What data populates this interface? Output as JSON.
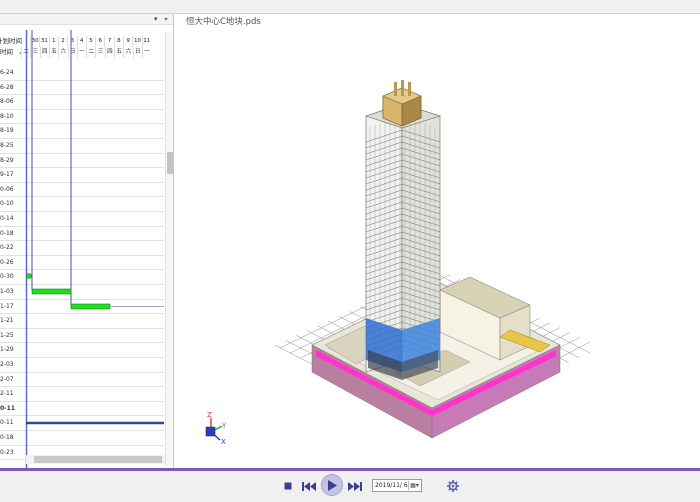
{
  "window": {
    "view_title": "恒大中心C地块.pds"
  },
  "panel": {
    "header_controls": [
      "▾",
      "⌖"
    ],
    "col_header_1": "计划时间",
    "col_header_2": "时间",
    "sort_icon": "⌄",
    "days": [
      "30",
      "31",
      "1",
      "2",
      "3",
      "4",
      "5",
      "6",
      "7",
      "8",
      "9",
      "10",
      "11"
    ],
    "weekdays": [
      "二",
      "三",
      "四",
      "五",
      "六",
      "日",
      "一",
      "二",
      "三",
      "四",
      "五",
      "六",
      "日",
      "一"
    ],
    "rows": [
      "6-24",
      "6-28",
      "8-06",
      "8-10",
      "8-19",
      "8-25",
      "8-29",
      "9-17",
      "0-06",
      "0-10",
      "0-14",
      "0-18",
      "0-22",
      "0-26",
      "0-30",
      "1-03",
      "1-17",
      "1-21",
      "1-25",
      "1-29",
      "2-03",
      "2-07",
      "2-11",
      "0-11",
      "0-11",
      "0-18",
      "0-23"
    ]
  },
  "toolbar": {
    "date_value": "2019/11/ 6",
    "date_dropdown_icon": "▦▾"
  },
  "icons": {
    "stop": "stop-icon",
    "prev": "skip-back-icon",
    "play": "play-icon",
    "next": "skip-forward-icon",
    "settings": "gear-icon"
  },
  "colors": {
    "accent": "#7a5db3",
    "gantt_bar": "#22dd22",
    "today_line": "#2b4d86",
    "axis_x": "#1d3bd6",
    "axis_y": "#2aa835",
    "axis_z": "#d63a3a"
  }
}
